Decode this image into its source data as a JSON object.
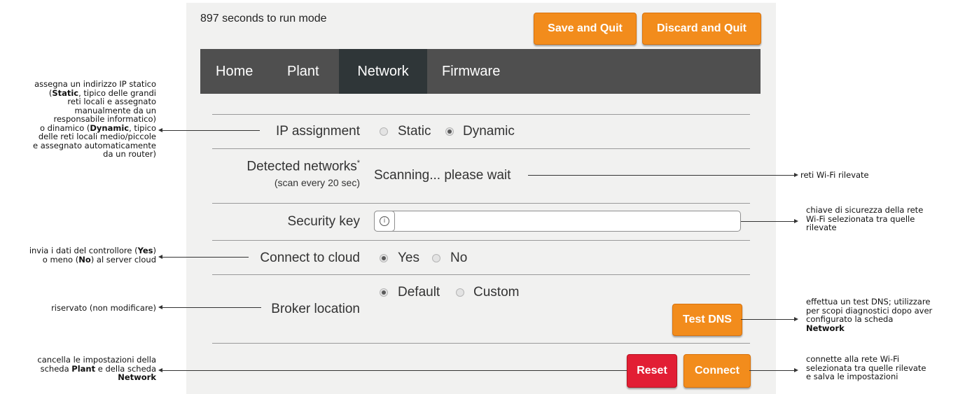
{
  "header": {
    "countdown": "897 seconds to run mode",
    "save_quit": "Save and Quit",
    "discard_quit": "Discard and Quit"
  },
  "nav": {
    "tabs": [
      "Home",
      "Plant",
      "Network",
      "Firmware"
    ],
    "active": "Network"
  },
  "form": {
    "ip_label": "IP assignment",
    "ip_options": [
      "Static",
      "Dynamic"
    ],
    "ip_selected": "Dynamic",
    "detected_label": "Detected networks",
    "detected_asterisk": "*",
    "detected_sub": "(scan every 20 sec)",
    "detected_value": "Scanning... please wait",
    "security_label": "Security key",
    "security_value": "",
    "security_icon": "info-icon",
    "cloud_label": "Connect to cloud",
    "cloud_options": [
      "Yes",
      "No"
    ],
    "cloud_selected": "Yes",
    "broker_label": "Broker location",
    "broker_options": [
      "Default",
      "Custom"
    ],
    "broker_selected": "Default",
    "test_dns": "Test DNS",
    "reset": "Reset",
    "connect": "Connect"
  },
  "annotations": {
    "ip": "assegna un indirizzo IP statico\n(Static, tipico delle grandi\nreti locali e assegnato\nmanualmente da un\nresponsabile informatico)\no dinamico (Dynamic, tipico\ndelle reti locali medio/piccole\ne assegnato automaticamente\nda un router)",
    "networks": "reti Wi-Fi rilevate",
    "security": "chiave di sicurezza della rete\nWi-Fi selezionata tra quelle\nrilevate",
    "cloud": "invia i dati del controllore (Yes)\no meno (No) al server cloud",
    "broker": "riservato (non modificare)",
    "test_dns": "effettua un test DNS; utilizzare\nper scopi diagnostici dopo aver\nconfigurato la scheda\nNetwork",
    "reset": "cancella le impostazioni della\nscheda Plant e della scheda\nNetwork",
    "connect": "connette alla rete Wi-Fi\nselezionata tra quelle rilevate\ne salva le impostazioni"
  },
  "colors": {
    "orange": "#f28c1c",
    "red": "#e21e34",
    "nav_bg": "#4f4f4f",
    "nav_active": "#2f3638",
    "panel_bg": "#f1f1f0"
  }
}
